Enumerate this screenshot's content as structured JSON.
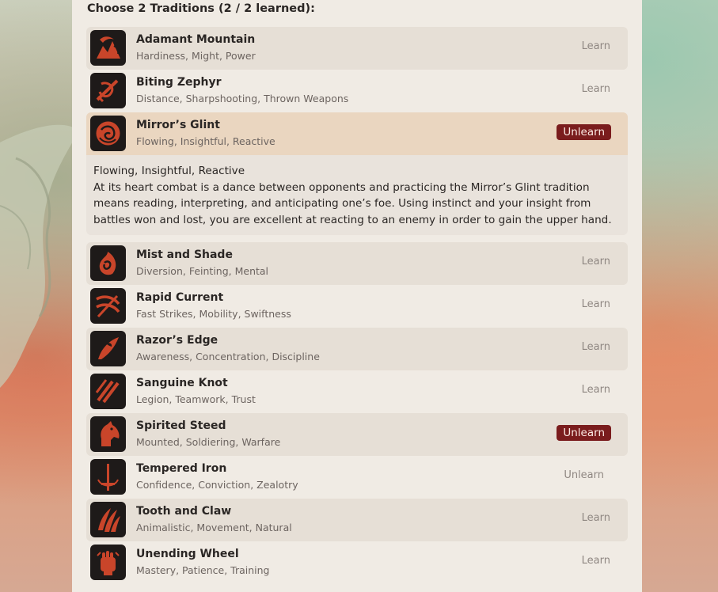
{
  "heading": "Choose 2 Traditions (2 / 2 learned):",
  "accent_color": "#7a1c1d",
  "icon_color": "#c9452a",
  "traditions": [
    {
      "name": "Adamant Mountain",
      "tags": "Hardiness, Might, Power",
      "action": "Learn",
      "icon": "mountain-icon"
    },
    {
      "name": "Biting Zephyr",
      "tags": "Distance, Sharpshooting, Thrown Weapons",
      "action": "Learn",
      "icon": "zephyr-icon"
    },
    {
      "name": "Mirror’s Glint",
      "tags": "Flowing, Insightful, Reactive",
      "action": "Unlearn",
      "icon": "mirror-icon"
    },
    {
      "name": "Mist and Shade",
      "tags": "Diversion, Feinting, Mental",
      "action": "Learn",
      "icon": "mist-icon"
    },
    {
      "name": "Rapid Current",
      "tags": "Fast Strikes, Mobility, Swiftness",
      "action": "Learn",
      "icon": "current-icon"
    },
    {
      "name": "Razor’s Edge",
      "tags": "Awareness, Concentration, Discipline",
      "action": "Learn",
      "icon": "razor-icon"
    },
    {
      "name": "Sanguine Knot",
      "tags": "Legion, Teamwork, Trust",
      "action": "Learn",
      "icon": "knot-icon"
    },
    {
      "name": "Spirited Steed",
      "tags": "Mounted, Soldiering, Warfare",
      "action": "Unlearn",
      "icon": "horse-icon"
    },
    {
      "name": "Tempered Iron",
      "tags": "Confidence, Conviction, Zealotry",
      "action": "Unlearn",
      "icon": "sword-icon"
    },
    {
      "name": "Tooth and Claw",
      "tags": "Animalistic, Movement, Natural",
      "action": "Learn",
      "icon": "claw-icon"
    },
    {
      "name": "Unending Wheel",
      "tags": "Mastery, Patience, Training",
      "action": "Learn",
      "icon": "fist-icon"
    }
  ],
  "expanded": {
    "tags": "Flowing, Insightful, Reactive",
    "description": "At its heart combat is a dance between opponents and practicing the Mirror’s Glint tradition means reading, interpreting, and anticipating one’s foe. Using instinct and your insight from battles won and lost, you are excellent at reacting to an enemy in order to gain the upper hand."
  }
}
